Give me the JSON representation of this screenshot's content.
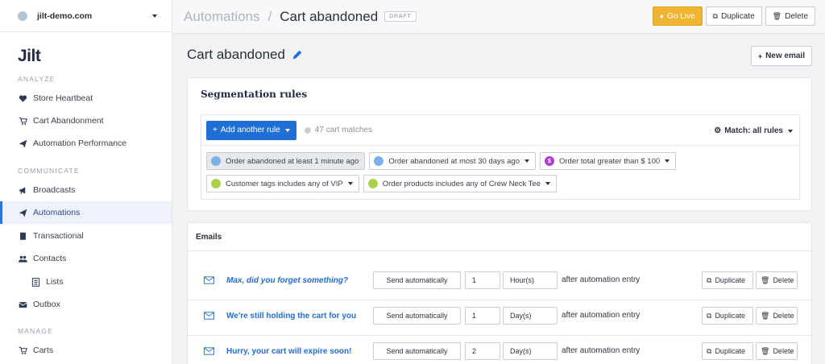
{
  "site": {
    "name": "jilt-demo.com"
  },
  "logo": "Jilt",
  "sidebar": {
    "sections": [
      {
        "title": "ANALYZE"
      },
      {
        "title": "COMMUNICATE"
      },
      {
        "title": "MANAGE"
      }
    ],
    "items": [
      {
        "label": "Store Heartbeat",
        "icon": "heart-icon"
      },
      {
        "label": "Cart Abandonment",
        "icon": "cart-icon"
      },
      {
        "label": "Automation Performance",
        "icon": "paper-plane-icon"
      },
      {
        "label": "Broadcasts",
        "icon": "bullhorn-icon"
      },
      {
        "label": "Automations",
        "icon": "paper-plane-icon",
        "active": true
      },
      {
        "label": "Transactional",
        "icon": "receipt-icon"
      },
      {
        "label": "Contacts",
        "icon": "users-icon"
      },
      {
        "label": "Lists",
        "icon": "list-icon"
      },
      {
        "label": "Outbox",
        "icon": "envelope-icon"
      },
      {
        "label": "Carts",
        "icon": "cart-icon"
      }
    ]
  },
  "topbar": {
    "breadcrumb_parent": "Automations",
    "breadcrumb_separator": "/",
    "breadcrumb_current": "Cart abandoned",
    "status_badge": "DRAFT",
    "go_live_label": "Go Live",
    "duplicate_label": "Duplicate",
    "delete_label": "Delete"
  },
  "main": {
    "title": "Cart abandoned",
    "new_email_label": "New email"
  },
  "segmentation": {
    "title": "Segmentation rules",
    "add_rule_label": "Add another rule",
    "matches": "47 cart matches",
    "match_label": "Match: all rules",
    "rules": [
      {
        "label": "Order abandoned at least 1 minute ago",
        "icon_color": "#7fb0e6",
        "selected": true
      },
      {
        "label": "Order abandoned at most 30 days ago",
        "icon_color": "#7fb0e6"
      },
      {
        "label": "Order total greater than $ 100",
        "icon_color": "#b23bd1",
        "glyph": "$"
      },
      {
        "label": "Customer tags includes any of VIP",
        "icon_color": "#a9d44a"
      },
      {
        "label": "Order products includes any of Crew Neck Tee",
        "icon_color": "#a9d44a"
      }
    ]
  },
  "emails": {
    "title": "Emails",
    "rows": [
      {
        "name": "Max, did you forget something?",
        "send": "Send automatically",
        "delay": "1",
        "unit": "Hour(s)",
        "after": "after automation entry",
        "duplicate": "Duplicate",
        "delete": "Delete"
      },
      {
        "name": "We're still holding the cart for you",
        "send": "Send automatically",
        "delay": "1",
        "unit": "Day(s)",
        "after": "after automation entry",
        "duplicate": "Duplicate",
        "delete": "Delete"
      },
      {
        "name": "Hurry, your cart will expire soon!",
        "send": "Send automatically",
        "delay": "2",
        "unit": "Day(s)",
        "after": "after automation entry",
        "duplicate": "Duplicate",
        "delete": "Delete"
      }
    ]
  },
  "colors": {
    "accent_blue": "#1f6fd6",
    "go_live": "#f0b431",
    "active_nav_bar": "#2a73e8"
  }
}
